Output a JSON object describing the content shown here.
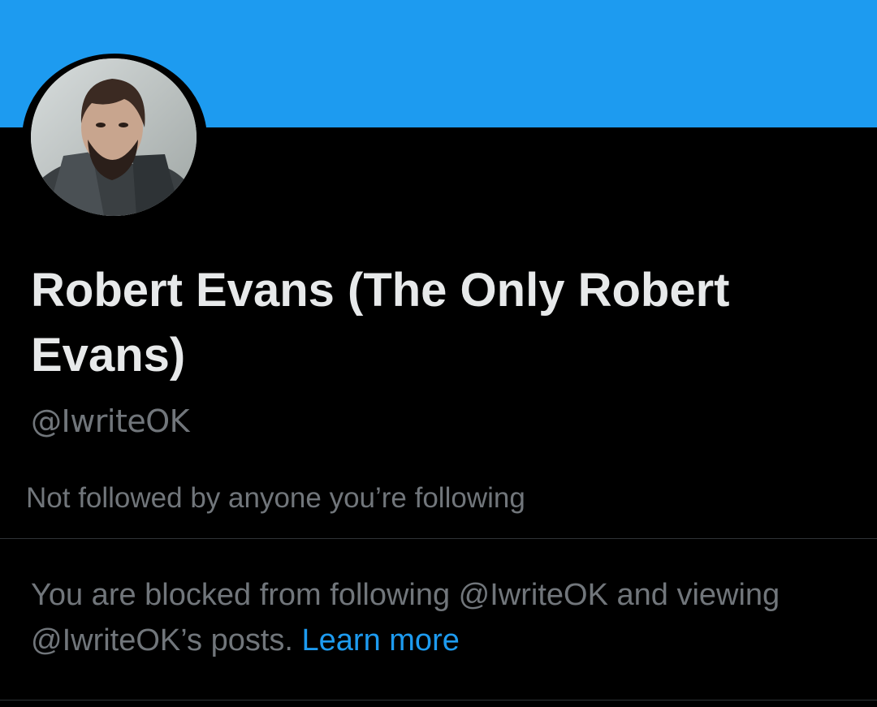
{
  "profile": {
    "display_name": "Robert Evans (The Only Robert Evans)",
    "handle": "@IwriteOK",
    "followers_you_know": "Not followed by anyone you’re following"
  },
  "block_notice": {
    "text_part1": "You are blocked from following @IwriteOK and viewing @IwriteOK’s posts. ",
    "learn_more": "Learn more"
  },
  "colors": {
    "banner": "#1d9bf0",
    "background": "#000000",
    "primary_text": "#e7e9ea",
    "secondary_text": "#71767b",
    "link": "#1d9bf0",
    "divider": "#2f3336"
  },
  "icons": {
    "avatar": "profile-photo-avatar"
  }
}
